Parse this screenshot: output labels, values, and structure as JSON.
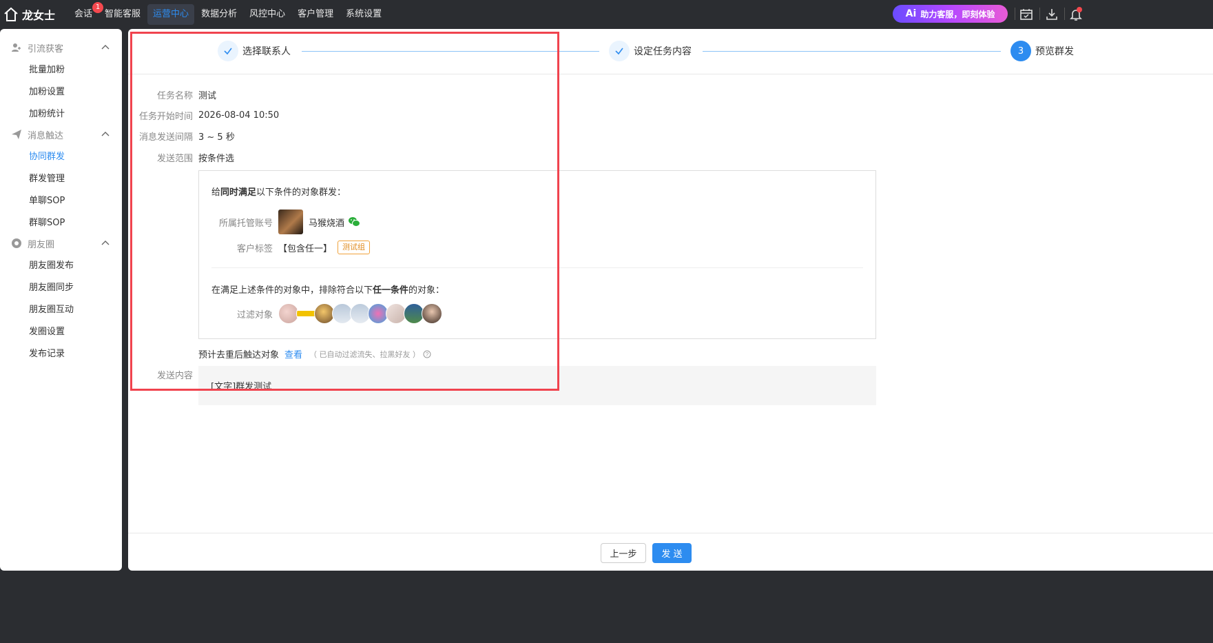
{
  "app": {
    "name": "龙女士"
  },
  "nav": {
    "items": [
      {
        "label": "会话",
        "badge": "1"
      },
      {
        "label": "智能客服"
      },
      {
        "label": "运营中心",
        "active": true
      },
      {
        "label": "数据分析"
      },
      {
        "label": "风控中心"
      },
      {
        "label": "客户管理"
      },
      {
        "label": "系统设置"
      }
    ]
  },
  "ai_button": {
    "mark": "Ai",
    "label": "助力客服，即刻体验"
  },
  "sidebar": {
    "groups": [
      {
        "label": "引流获客",
        "icon": "user-add-icon",
        "items": [
          "批量加粉",
          "加粉设置",
          "加粉统计"
        ]
      },
      {
        "label": "消息触达",
        "icon": "paper-plane-icon",
        "items": [
          "协同群发",
          "群发管理",
          "单聊SOP",
          "群聊SOP"
        ],
        "active": "协同群发"
      },
      {
        "label": "朋友圈",
        "icon": "aperture-icon",
        "items": [
          "朋友圈发布",
          "朋友圈同步",
          "朋友圈互动",
          "发圈设置",
          "发布记录"
        ]
      }
    ]
  },
  "steps": [
    {
      "label": "选择联系人",
      "state": "done"
    },
    {
      "label": "设定任务内容",
      "state": "done"
    },
    {
      "label": "预览群发",
      "state": "current",
      "number": "3"
    }
  ],
  "form": {
    "task_name": {
      "label": "任务名称",
      "value": "测试"
    },
    "start_time": {
      "label": "任务开始时间",
      "value": "2026-08-04 10:50"
    },
    "interval": {
      "label": "消息发送间隔",
      "value": "3 ~ 5 秒"
    },
    "scope": {
      "label": "发送范围",
      "value": "按条件选"
    },
    "conditions": {
      "title_pre": "给",
      "title_bold": "同时满足",
      "title_post": "以下条件的对象群发：",
      "account": {
        "label": "所属托管账号",
        "value": "马猴烧酒"
      },
      "tags": {
        "label": "客户标签",
        "mode": "【包含任一】",
        "tag": "测试组"
      },
      "exclude_pre": "在满足上述条件的对象中，排除符合以下",
      "exclude_bold": "任一条件",
      "exclude_post": "的对象：",
      "filter": {
        "label": "过滤对象"
      }
    },
    "estimate": {
      "label": "预计去重后触达对象",
      "link": "查看",
      "note": "（ 已自动过滤流失、拉黑好友 ）"
    },
    "content": {
      "label": "发送内容",
      "value": "[文字]群发测试"
    }
  },
  "footer": {
    "prev": "上一步",
    "send": "发 送"
  },
  "colors": {
    "accent": "#2d8cf0",
    "highlight_frame": "#f0434e",
    "topbar": "#2b2d31",
    "tag": "#e08a1e"
  }
}
